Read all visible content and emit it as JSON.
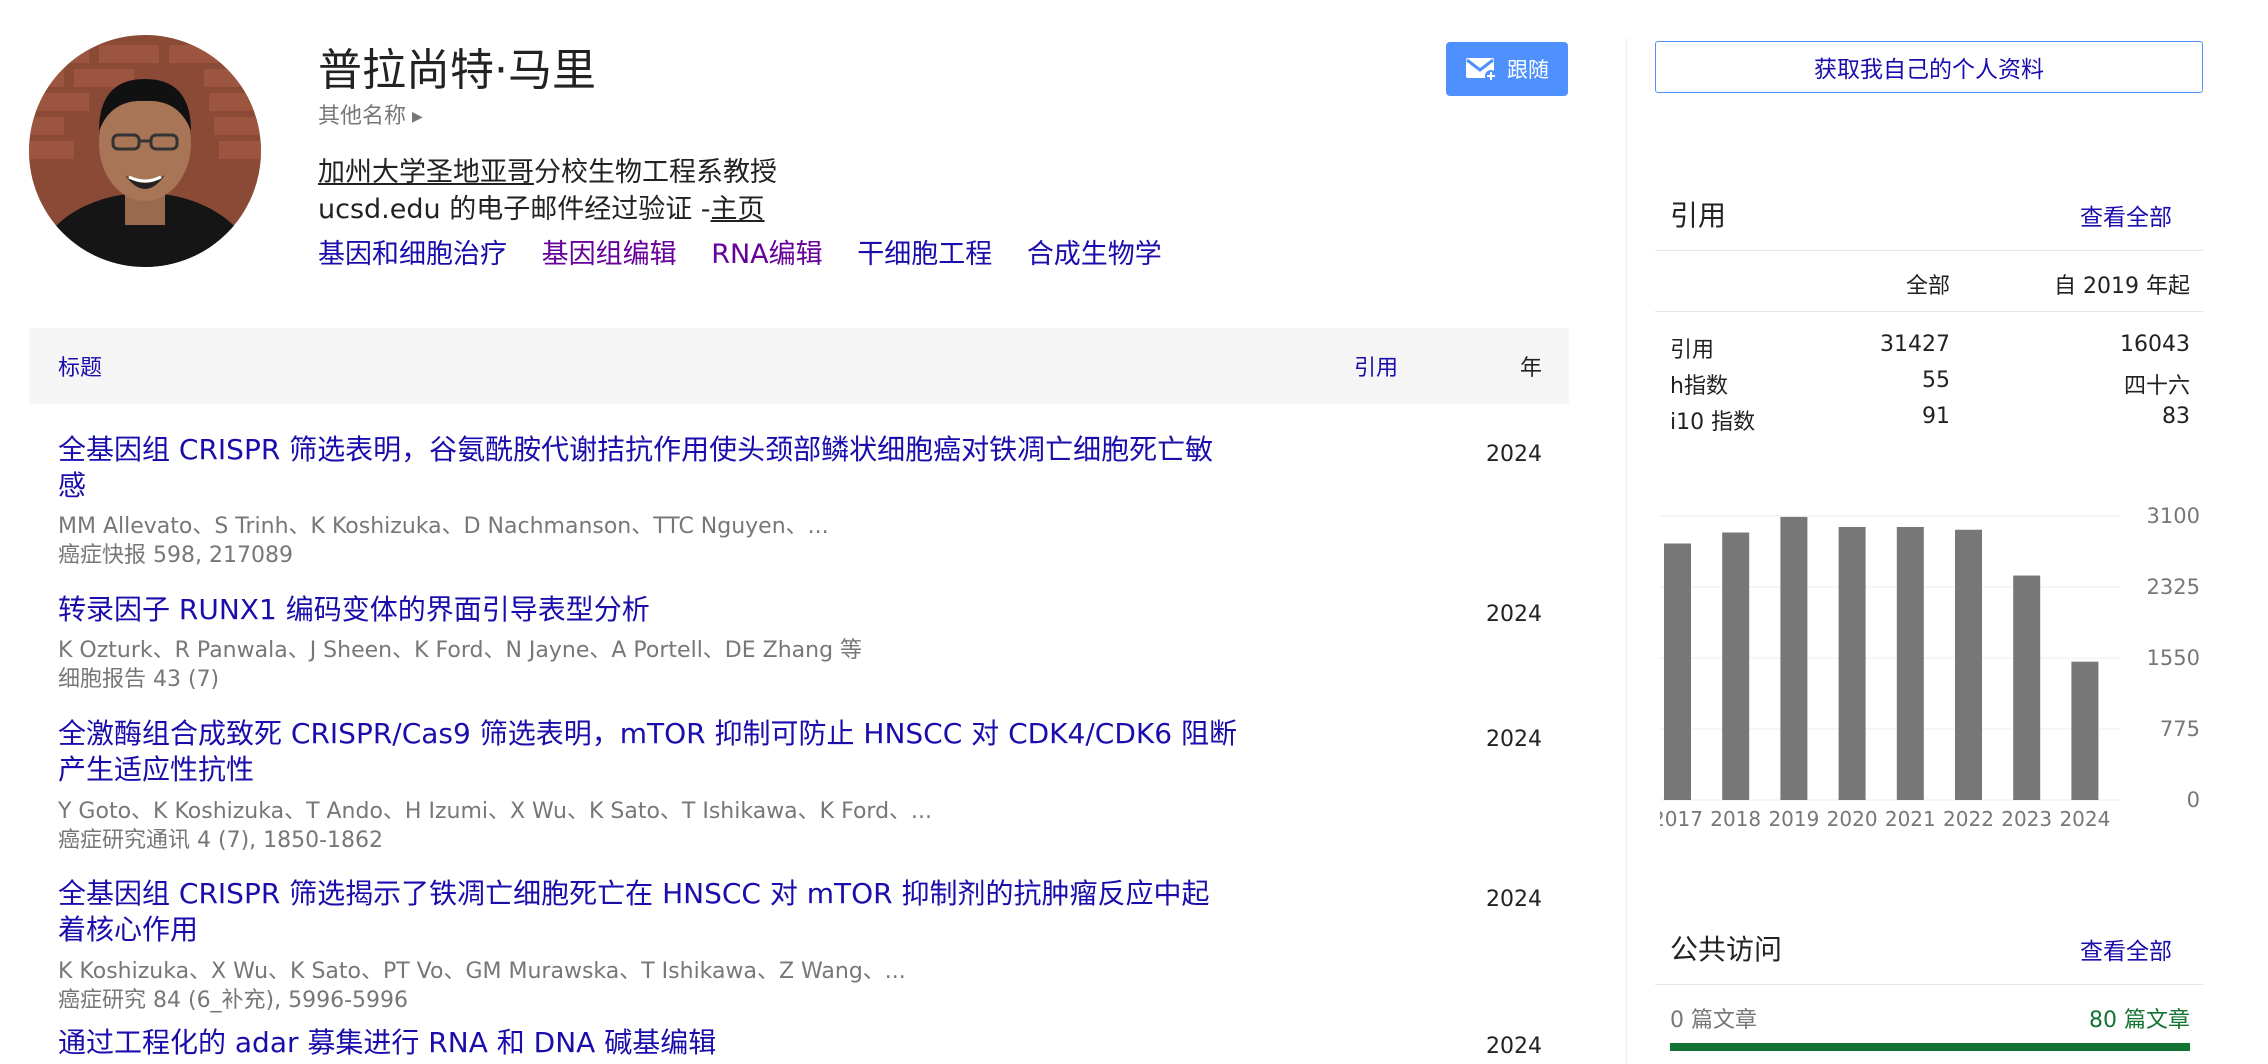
{
  "profile": {
    "name": "普拉尚特·马里",
    "other_names": "其他名称",
    "affiliation_link": "加州大学圣地亚哥",
    "affiliation_rest": "分校生物工程系教授",
    "email_text": "ucsd.edu 的电子邮件经过验证 -",
    "homepage": "主页",
    "interests": [
      "基因和细胞治疗",
      "基因组编辑",
      "RNA编辑",
      "干细胞工程",
      "合成生物学"
    ],
    "follow_label": "跟随"
  },
  "table": {
    "col_title": "标题",
    "col_cited": "引用",
    "col_year": "年",
    "rows": [
      {
        "title_line1": "全基因组 CRISPR 筛选表明，谷氨酰胺代谢拮抗作用使头颈部鳞状细胞癌对铁凋亡细胞死亡敏",
        "title_line2": "感",
        "authors": "MM Allevato、S Trinh、K Koshizuka、D Nachmanson、TTC Nguyen、...",
        "venue": "癌症快报 598, 217089",
        "year": "2024"
      },
      {
        "title_line1": "转录因子 RUNX1 编码变体的界面引导表型分析",
        "title_line2": "",
        "authors": "K Ozturk、R Panwala、J Sheen、K Ford、N Jayne、A Portell、DE Zhang 等",
        "venue": "细胞报告 43 (7)",
        "year": "2024"
      },
      {
        "title_line1": "全激酶组合成致死 CRISPR/Cas9 筛选表明，mTOR 抑制可防止 HNSCC 对 CDK4/CDK6 阻断",
        "title_line2": "产生适应性抗性",
        "authors": "Y Goto、K Koshizuka、T Ando、H Izumi、X Wu、K Sato、T Ishikawa、K Ford、...",
        "venue": "癌症研究通讯 4 (7), 1850-1862",
        "year": "2024"
      },
      {
        "title_line1": "全基因组 CRISPR 筛选揭示了铁凋亡细胞死亡在 HNSCC 对 mTOR 抑制剂的抗肿瘤反应中起",
        "title_line2": "着核心作用",
        "authors": "K Koshizuka、X Wu、K Sato、PT Vo、GM Murawska、T Ishikawa、Z Wang、...",
        "venue": "癌症研究 84 (6_补充), 5996-5996",
        "year": "2024"
      },
      {
        "title_line1": "通过工程化的 adar 募集进行 RNA 和 DNA 碱基编辑",
        "title_line2": "",
        "authors": "",
        "venue": "",
        "year": "2024"
      }
    ]
  },
  "sidebar": {
    "get_profile": "获取我自己的个人资料",
    "citations": {
      "title": "引用",
      "view_all": "查看全部",
      "col_all": "全部",
      "col_since": "自 2019 年起",
      "rows": [
        {
          "label": "引用",
          "all": "31427",
          "since": "16043"
        },
        {
          "label": "h指数",
          "all": "55",
          "since": "四十六"
        },
        {
          "label": "i10 指数",
          "all": "91",
          "since": "83"
        }
      ]
    },
    "public_access": {
      "title": "公共访问",
      "view_all": "查看全部",
      "left": "0 篇文章",
      "right": "80 篇文章"
    }
  },
  "chart_data": {
    "type": "bar",
    "categories": [
      "2017",
      "2018",
      "2019",
      "2020",
      "2021",
      "2022",
      "2023",
      "2024"
    ],
    "values": [
      2800,
      2920,
      3090,
      2980,
      2980,
      2950,
      2450,
      1510
    ],
    "ylim": [
      0,
      3100
    ],
    "yticks": [
      "3100",
      "2325",
      "1550",
      "775",
      "0"
    ],
    "grid": true,
    "bar_color": "#777777"
  }
}
